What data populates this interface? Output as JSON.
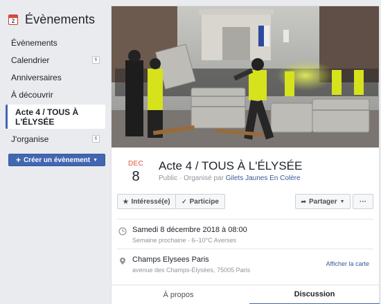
{
  "sidebar": {
    "calendar_icon_number": "2",
    "title": "Évènements",
    "items": [
      {
        "label": "Évènements",
        "count": ""
      },
      {
        "label": "Calendrier",
        "count": "6"
      },
      {
        "label": "Anniversaires",
        "count": ""
      },
      {
        "label": "À découvrir",
        "count": ""
      },
      {
        "label": "Acte 4 / TOUS À L'ÉLYSÉE",
        "count": ""
      },
      {
        "label": "J'organise",
        "count": "6"
      }
    ],
    "create_button": "Créer un évènement"
  },
  "event": {
    "date_month": "DEC",
    "date_day": "8",
    "title": "Acte 4 / TOUS À L'ÉLYSÉE",
    "visibility": "Public",
    "organized_by": "Organisé par",
    "organizer": "Gilets Jaunes En Colère",
    "buttons": {
      "interested": "Intéressé(e)",
      "going": "Participe",
      "share": "Partager",
      "more": "···"
    },
    "time": {
      "main": "Samedi 8 décembre 2018 à 08:00",
      "sub": "Semaine prochaine · 6–10°C Averses"
    },
    "location": {
      "main": "Champs Elysees Paris",
      "sub": "avenue des Champs-Élysées, 75005 Paris",
      "map_link": "Afficher la carte"
    },
    "tabs": [
      "À propos",
      "Discussion"
    ]
  },
  "colors": {
    "accent": "#4267b2",
    "month_red": "#e44e3b",
    "link": "#385898",
    "vest_yellow": "#d6e21c"
  },
  "icons": {
    "calendar": "calendar-icon",
    "star": "star-icon",
    "check": "check-icon",
    "share": "share-arrow-icon",
    "clock": "clock-icon",
    "pin": "map-pin-icon"
  }
}
